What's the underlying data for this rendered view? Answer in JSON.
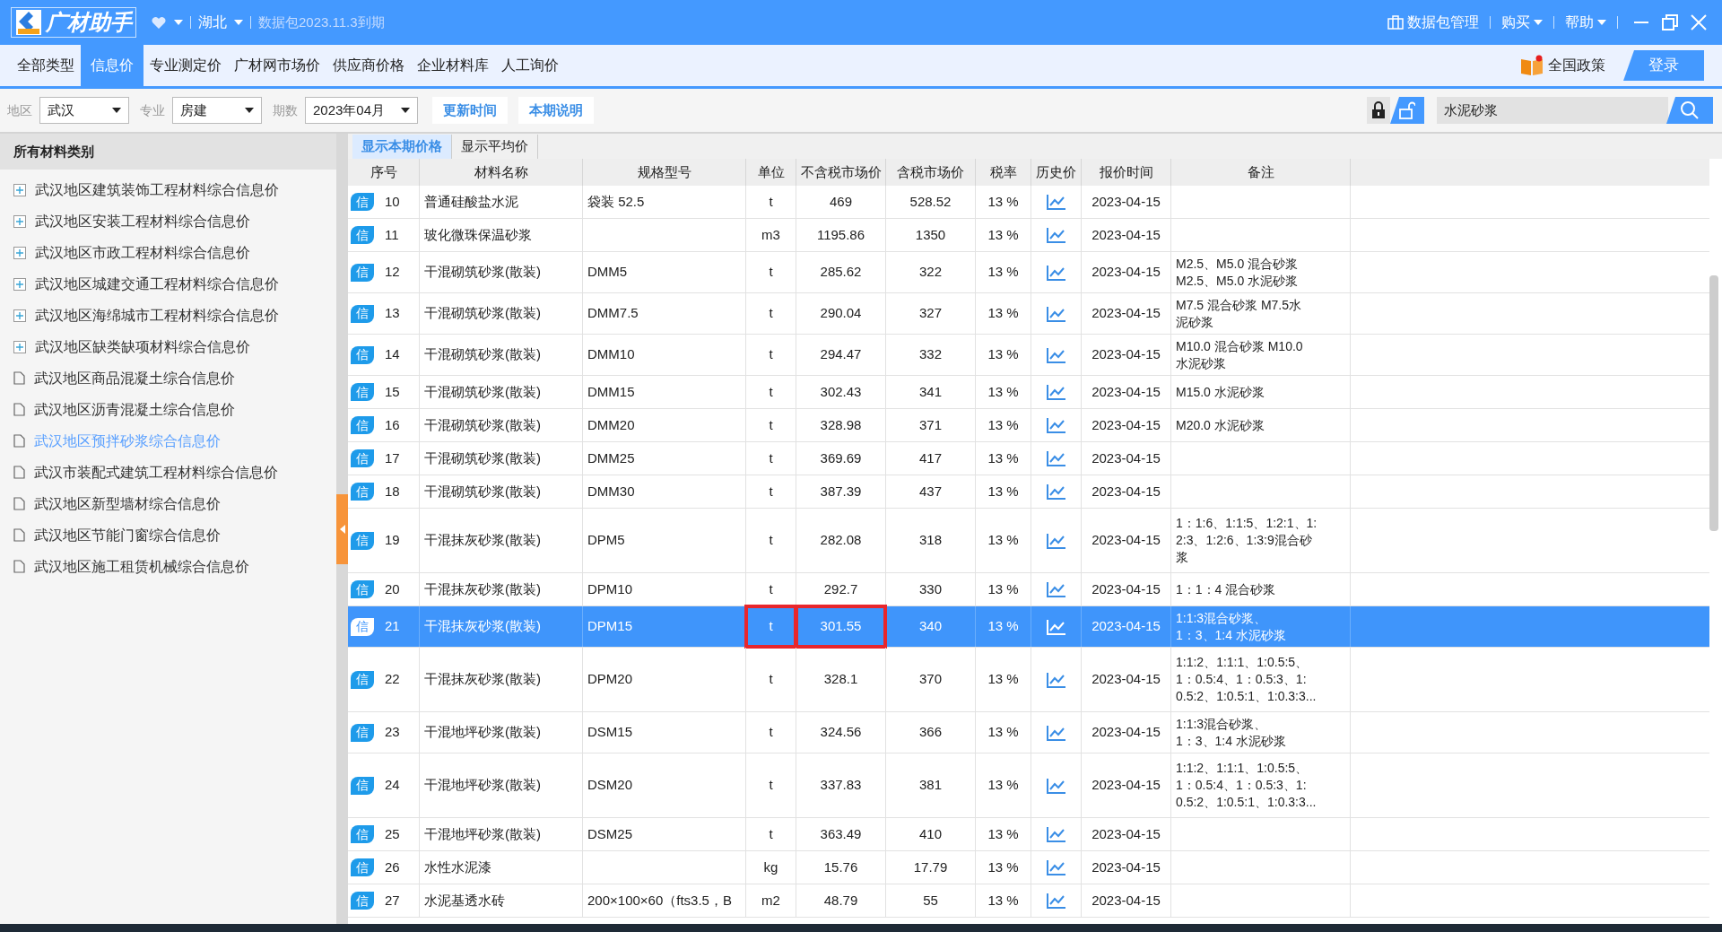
{
  "title_bar": {
    "app_name": "广材助手",
    "region": "湖北",
    "expiry": "数据包2023.11.3到期",
    "actions": [
      "数据包管理",
      "购买",
      "帮助"
    ]
  },
  "nav_tabs": [
    {
      "label": "全部类型",
      "selected": false
    },
    {
      "label": "信息价",
      "selected": true
    },
    {
      "label": "专业测定价",
      "selected": false
    },
    {
      "label": "广材网市场价",
      "selected": false
    },
    {
      "label": "供应商价格",
      "selected": false
    },
    {
      "label": "企业材料库",
      "selected": false
    },
    {
      "label": "人工询价",
      "selected": false
    }
  ],
  "policy_link": "全国政策",
  "login_button": "登录",
  "filters": [
    {
      "label": "地区",
      "value": "武汉"
    },
    {
      "label": "专业",
      "value": "房建"
    },
    {
      "label": "期数",
      "value": "2023年04月"
    }
  ],
  "filter_buttons": [
    "更新时间",
    "本期说明"
  ],
  "search": {
    "value": "水泥砂浆"
  },
  "sidebar": {
    "title": "所有材料类别",
    "items": [
      {
        "kind": "group",
        "label": "武汉地区建筑装饰工程材料综合信息价",
        "selected": false
      },
      {
        "kind": "group",
        "label": "武汉地区安装工程材料综合信息价",
        "selected": false
      },
      {
        "kind": "group",
        "label": "武汉地区市政工程材料综合信息价",
        "selected": false
      },
      {
        "kind": "group",
        "label": "武汉地区城建交通工程材料综合信息价",
        "selected": false
      },
      {
        "kind": "group",
        "label": "武汉地区海绵城市工程材料综合信息价",
        "selected": false
      },
      {
        "kind": "group",
        "label": "武汉地区缺类缺项材料综合信息价",
        "selected": false
      },
      {
        "kind": "leaf",
        "label": "武汉地区商品混凝土综合信息价",
        "selected": false
      },
      {
        "kind": "leaf",
        "label": "武汉地区沥青混凝土综合信息价",
        "selected": false
      },
      {
        "kind": "leaf",
        "label": "武汉地区预拌砂浆综合信息价",
        "selected": true
      },
      {
        "kind": "leaf",
        "label": "武汉市装配式建筑工程材料综合信息价",
        "selected": false
      },
      {
        "kind": "leaf",
        "label": "武汉地区新型墙材综合信息价",
        "selected": false
      },
      {
        "kind": "leaf",
        "label": "武汉地区节能门窗综合信息价",
        "selected": false
      },
      {
        "kind": "leaf",
        "label": "武汉地区施工租赁机械综合信息价",
        "selected": false
      }
    ]
  },
  "view_tabs": [
    {
      "label": "显示本期价格",
      "selected": true
    },
    {
      "label": "显示平均价",
      "selected": false
    }
  ],
  "table": {
    "columns": [
      "序号",
      "材料名称",
      "规格型号",
      "单位",
      "不含税市场价",
      "含税市场价",
      "税率",
      "历史价",
      "报价时间",
      "备注"
    ],
    "rows": [
      {
        "badge": "信",
        "seq": "10",
        "name": "普通硅酸盐水泥",
        "spec": "袋装 52.5",
        "unit": "t",
        "price_ex_tax": "469",
        "price_tax": "528.52",
        "tax_rate": "13 %",
        "date": "2023-04-15",
        "selected": false,
        "unit_boxed": false,
        "price_boxed": false
      },
      {
        "badge": "信",
        "seq": "11",
        "name": "玻化微珠保温砂浆",
        "unit": "m3",
        "price_ex_tax": "1195.86",
        "price_tax": "1350",
        "tax_rate": "13 %",
        "date": "2023-04-15",
        "selected": false,
        "unit_boxed": false,
        "price_boxed": false
      },
      {
        "badge": "信",
        "seq": "12",
        "name": "干混砌筑砂浆(散装)",
        "spec": "DMM5",
        "unit": "t",
        "price_ex_tax": "285.62",
        "price_tax": "322",
        "tax_rate": "13 %",
        "date": "2023-04-15",
        "note": [
          "M2.5、M5.0 混合砂浆",
          "M2.5、M5.0 水泥砂浆"
        ],
        "selected": false,
        "unit_boxed": false,
        "price_boxed": false
      },
      {
        "badge": "信",
        "seq": "13",
        "name": "干混砌筑砂浆(散装)",
        "spec": "DMM7.5",
        "unit": "t",
        "price_ex_tax": "290.04",
        "price_tax": "327",
        "tax_rate": "13 %",
        "date": "2023-04-15",
        "note": [
          "M7.5 混合砂浆  M7.5水",
          "泥砂浆"
        ],
        "selected": false,
        "unit_boxed": false,
        "price_boxed": false
      },
      {
        "badge": "信",
        "seq": "14",
        "name": "干混砌筑砂浆(散装)",
        "spec": "DMM10",
        "unit": "t",
        "price_ex_tax": "294.47",
        "price_tax": "332",
        "tax_rate": "13 %",
        "date": "2023-04-15",
        "note": [
          "M10.0 混合砂浆  M10.0",
          "水泥砂浆"
        ],
        "selected": false,
        "unit_boxed": false,
        "price_boxed": false
      },
      {
        "badge": "信",
        "seq": "15",
        "name": "干混砌筑砂浆(散装)",
        "spec": "DMM15",
        "unit": "t",
        "price_ex_tax": "302.43",
        "price_tax": "341",
        "tax_rate": "13 %",
        "date": "2023-04-15",
        "note": [
          "M15.0 水泥砂浆"
        ],
        "selected": false,
        "unit_boxed": false,
        "price_boxed": false
      },
      {
        "badge": "信",
        "seq": "16",
        "name": "干混砌筑砂浆(散装)",
        "spec": "DMM20",
        "unit": "t",
        "price_ex_tax": "328.98",
        "price_tax": "371",
        "tax_rate": "13 %",
        "date": "2023-04-15",
        "note": [
          "M20.0 水泥砂浆"
        ],
        "selected": false,
        "unit_boxed": false,
        "price_boxed": false
      },
      {
        "badge": "信",
        "seq": "17",
        "name": "干混砌筑砂浆(散装)",
        "spec": "DMM25",
        "unit": "t",
        "price_ex_tax": "369.69",
        "price_tax": "417",
        "tax_rate": "13 %",
        "date": "2023-04-15",
        "selected": false,
        "unit_boxed": false,
        "price_boxed": false
      },
      {
        "badge": "信",
        "seq": "18",
        "name": "干混砌筑砂浆(散装)",
        "spec": "DMM30",
        "unit": "t",
        "price_ex_tax": "387.39",
        "price_tax": "437",
        "tax_rate": "13 %",
        "date": "2023-04-15",
        "selected": false,
        "unit_boxed": false,
        "price_boxed": false
      },
      {
        "badge": "信",
        "seq": "19",
        "name": "干混抹灰砂浆(散装)",
        "spec": "DPM5",
        "unit": "t",
        "price_ex_tax": "282.08",
        "price_tax": "318",
        "tax_rate": "13 %",
        "date": "2023-04-15",
        "note": [
          "1：1:6、1:1:5、1:2:1、1:",
          "2:3、1:2:6、1:3:9混合砂",
          "浆"
        ],
        "selected": false,
        "unit_boxed": false,
        "price_boxed": false
      },
      {
        "badge": "信",
        "seq": "20",
        "name": "干混抹灰砂浆(散装)",
        "spec": "DPM10",
        "unit": "t",
        "price_ex_tax": "292.7",
        "price_tax": "330",
        "tax_rate": "13 %",
        "date": "2023-04-15",
        "note": [
          "1：1：4 混合砂浆"
        ],
        "selected": false,
        "unit_boxed": false,
        "price_boxed": false
      },
      {
        "badge": "信",
        "seq": "21",
        "name": "干混抹灰砂浆(散装)",
        "spec": "DPM15",
        "unit": "t",
        "price_ex_tax": "301.55",
        "price_tax": "340",
        "tax_rate": "13 %",
        "date": "2023-04-15",
        "note": [
          "1:1:3混合砂浆、",
          "1：3、1:4 水泥砂浆"
        ],
        "selected": true,
        "unit_boxed": true,
        "price_boxed": true
      },
      {
        "badge": "信",
        "seq": "22",
        "name": "干混抹灰砂浆(散装)",
        "spec": "DPM20",
        "unit": "t",
        "price_ex_tax": "328.1",
        "price_tax": "370",
        "tax_rate": "13 %",
        "date": "2023-04-15",
        "note": [
          "1:1:2、1:1:1、1:0.5:5、",
          "1：0.5:4、1：0.5:3、1:",
          "0.5:2、1:0.5:1、1:0.3:3..."
        ],
        "selected": false,
        "unit_boxed": false,
        "price_boxed": false
      },
      {
        "badge": "信",
        "seq": "23",
        "name": "干混地坪砂浆(散装)",
        "spec": "DSM15",
        "unit": "t",
        "price_ex_tax": "324.56",
        "price_tax": "366",
        "tax_rate": "13 %",
        "date": "2023-04-15",
        "note": [
          "1:1:3混合砂浆、",
          "1：3、1:4 水泥砂浆"
        ],
        "selected": false,
        "unit_boxed": false,
        "price_boxed": false
      },
      {
        "badge": "信",
        "seq": "24",
        "name": "干混地坪砂浆(散装)",
        "spec": "DSM20",
        "unit": "t",
        "price_ex_tax": "337.83",
        "price_tax": "381",
        "tax_rate": "13 %",
        "date": "2023-04-15",
        "note": [
          "1:1:2、1:1:1、1:0.5:5、",
          "1：0.5:4、1：0.5:3、1:",
          "0.5:2、1:0.5:1、1:0.3:3..."
        ],
        "selected": false,
        "unit_boxed": false,
        "price_boxed": false
      },
      {
        "badge": "信",
        "seq": "25",
        "name": "干混地坪砂浆(散装)",
        "spec": "DSM25",
        "unit": "t",
        "price_ex_tax": "363.49",
        "price_tax": "410",
        "tax_rate": "13 %",
        "date": "2023-04-15",
        "selected": false,
        "unit_boxed": false,
        "price_boxed": false
      },
      {
        "badge": "信",
        "seq": "26",
        "name": "水性水泥漆",
        "unit": "kg",
        "price_ex_tax": "15.76",
        "price_tax": "17.79",
        "tax_rate": "13 %",
        "date": "2023-04-15",
        "selected": false,
        "unit_boxed": false,
        "price_boxed": false
      },
      {
        "badge": "信",
        "seq": "27",
        "name": "水泥基透水砖",
        "spec": "200×100×60（fts3.5，B",
        "unit": "m2",
        "price_ex_tax": "48.79",
        "price_tax": "55",
        "tax_rate": "13 %",
        "date": "2023-04-15",
        "selected": false,
        "unit_boxed": false,
        "price_boxed": false
      }
    ]
  }
}
